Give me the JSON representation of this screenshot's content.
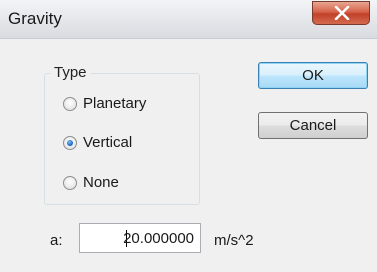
{
  "window": {
    "title": "Gravity"
  },
  "type_group": {
    "title": "Type",
    "options": [
      {
        "label": "Planetary",
        "checked": false
      },
      {
        "label": "Vertical",
        "checked": true
      },
      {
        "label": "None",
        "checked": false
      }
    ]
  },
  "buttons": {
    "ok": "OK",
    "cancel": "Cancel"
  },
  "acceleration": {
    "label": "a:",
    "value": "20.000000",
    "unit": "m/s^2"
  },
  "icons": {
    "close": "close-icon"
  }
}
